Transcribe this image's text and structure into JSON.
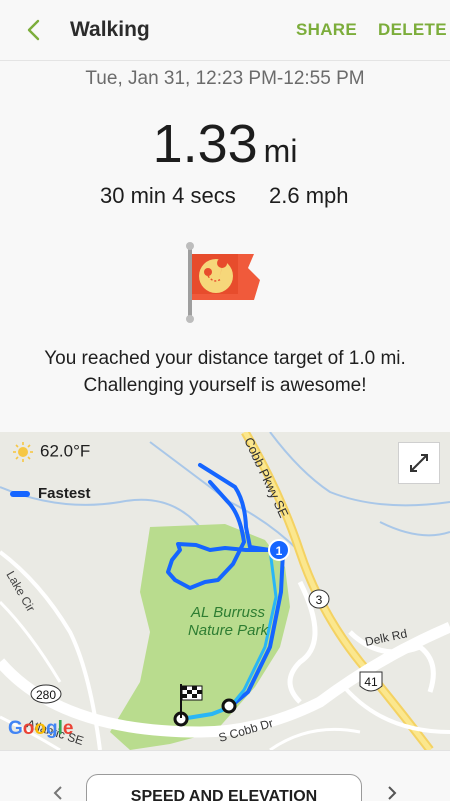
{
  "header": {
    "title": "Walking",
    "share_label": "SHARE",
    "delete_label": "DELETE"
  },
  "summary": {
    "date_range": "Tue, Jan 31, 12:23 PM-12:55 PM",
    "distance_value": "1.33",
    "distance_unit": "mi",
    "duration": "30 min 4 secs",
    "speed": "2.6 mph"
  },
  "achievement": {
    "line1": "You reached your distance target of 1.0 mi.",
    "line2": "Challenging yourself is awesome!"
  },
  "map": {
    "temperature": "62.0°F",
    "legend_label": "Fastest",
    "route_color": "#1565ff",
    "labels": {
      "cobb_pkwy": "Cobb Pkwy SE",
      "lake_cir": "Lake Cir",
      "park_line1": "AL Burruss",
      "park_line2": "Nature Park",
      "delk_rd": "Delk Rd",
      "s_cobb_dr": "S Cobb Dr",
      "atlantic": "Atlantic SE",
      "shield_280": "280",
      "shield_3": "3",
      "shield_41": "41",
      "marker_1": "1"
    },
    "google_logo": "Google"
  },
  "bottom": {
    "tab_label": "SPEED AND ELEVATION"
  },
  "colors": {
    "accent": "#7cad3b",
    "route": "#1565ff",
    "park": "#b9dc8e"
  }
}
